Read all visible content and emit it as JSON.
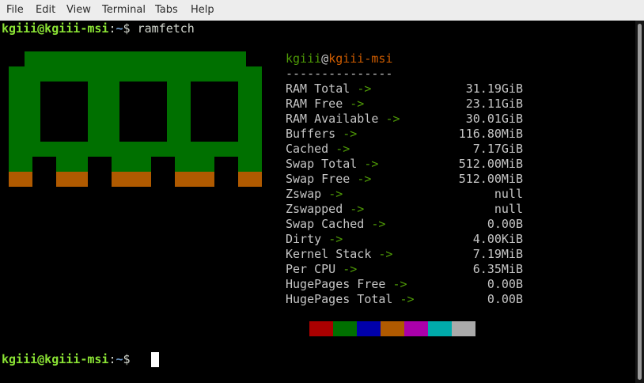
{
  "menubar": {
    "items": [
      "File",
      "Edit",
      "View",
      "Terminal",
      "Tabs",
      "Help"
    ]
  },
  "prompt1": {
    "user_host": "kgiii@kgiii-msi",
    "colon": ":",
    "path": "~",
    "dollar": "$ ",
    "command": "ramfetch"
  },
  "prompt2": {
    "user_host": "kgiii@kgiii-msi",
    "colon": ":",
    "path": "~",
    "dollar": "$ "
  },
  "info": {
    "user": "kgiii",
    "at": "@",
    "host": "kgiii-msi",
    "separator": "---------------",
    "rows": [
      {
        "label": "RAM Total",
        "value": "31.19GiB"
      },
      {
        "label": "RAM Free",
        "value": "23.11GiB"
      },
      {
        "label": "RAM Available",
        "value": "30.01GiB"
      },
      {
        "label": "Buffers",
        "value": "116.80MiB"
      },
      {
        "label": "Cached",
        "value": "7.17GiB"
      },
      {
        "label": "Swap Total",
        "value": "512.00MiB"
      },
      {
        "label": "Swap Free",
        "value": "512.00MiB"
      },
      {
        "label": "Zswap",
        "value": "null"
      },
      {
        "label": "Zswapped",
        "value": "null"
      },
      {
        "label": "Swap Cached",
        "value": "0.00B"
      },
      {
        "label": "Dirty",
        "value": "4.00KiB"
      },
      {
        "label": "Kernel Stack",
        "value": "7.19MiB"
      },
      {
        "label": "Per CPU",
        "value": "6.35MiB"
      },
      {
        "label": "HugePages Free",
        "value": "0.00B"
      },
      {
        "label": "HugePages Total",
        "value": "0.00B"
      }
    ],
    "arrow": "->"
  },
  "colors": {
    "logo_green": "#007000",
    "logo_orange": "#b05a00",
    "swatches": [
      "#aa0000",
      "#007000",
      "#0000aa",
      "#b05a00",
      "#aa00aa",
      "#00aaaa",
      "#aaaaaa"
    ]
  }
}
